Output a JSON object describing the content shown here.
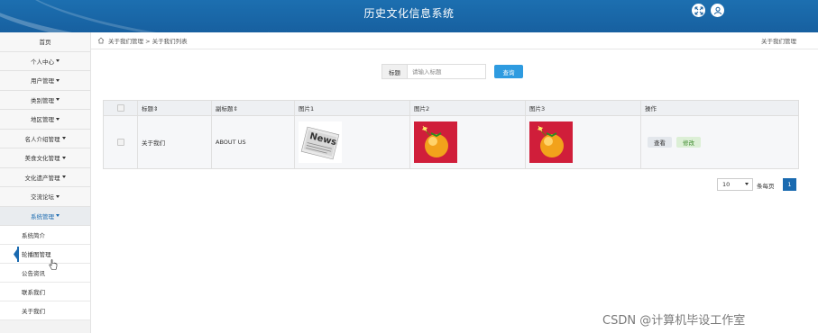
{
  "header": {
    "title": "历史文化信息系统",
    "icons": [
      "fullscreen-icon",
      "user-icon"
    ],
    "bg_color": "#1760a0"
  },
  "sidebar": {
    "items": [
      {
        "label": "首页",
        "has_caret": false
      },
      {
        "label": "个人中心",
        "has_caret": true
      },
      {
        "label": "用户管理",
        "has_caret": true
      },
      {
        "label": "类别管理",
        "has_caret": true
      },
      {
        "label": "地区管理",
        "has_caret": true
      },
      {
        "label": "名人介绍管理",
        "has_caret": true
      },
      {
        "label": "美食文化管理",
        "has_caret": true
      },
      {
        "label": "文化遗产管理",
        "has_caret": true
      },
      {
        "label": "交流论坛",
        "has_caret": true
      },
      {
        "label": "系统管理",
        "has_caret": true,
        "expanded": true
      }
    ],
    "sub_items": [
      {
        "label": "系统简介"
      },
      {
        "label": "轮播图管理",
        "selected": true
      },
      {
        "label": "公告资讯"
      },
      {
        "label": "联系我们"
      },
      {
        "label": "关于我们"
      }
    ]
  },
  "breadcrumb": {
    "path": "关于我们管理 > 关于我们列表",
    "right": "关于我们管理"
  },
  "search": {
    "label": "标题",
    "placeholder": "请输入标题",
    "value": "",
    "button": "查询"
  },
  "table": {
    "columns": [
      "",
      "标题⇕",
      "副标题⇕",
      "图片1",
      "图片2",
      "图片3",
      "操作"
    ],
    "rows": [
      {
        "title": "关于我们",
        "subtitle": "ABOUT US",
        "images": [
          "news-newspaper-image",
          "fruit-bomb-image",
          "fruit-bomb-image"
        ],
        "actions": [
          "查看",
          "修改"
        ]
      }
    ]
  },
  "pagination": {
    "page_size": "10",
    "per_page_label": "条每页",
    "current_page": "1"
  },
  "watermark": "CSDN @计算机毕设工作室"
}
